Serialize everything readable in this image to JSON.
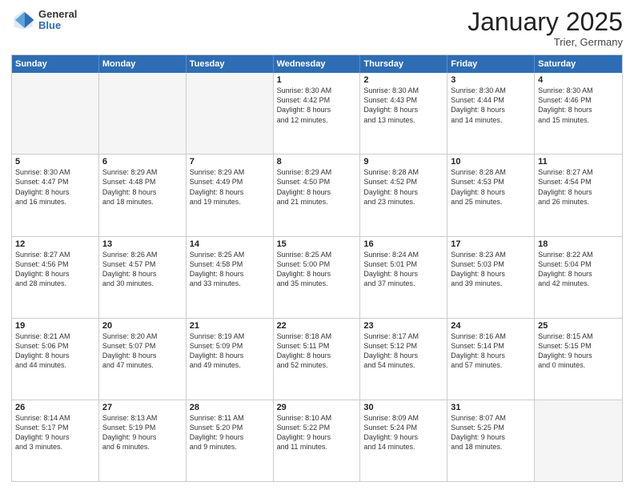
{
  "logo": {
    "general": "General",
    "blue": "Blue"
  },
  "title": "January 2025",
  "location": "Trier, Germany",
  "header_days": [
    "Sunday",
    "Monday",
    "Tuesday",
    "Wednesday",
    "Thursday",
    "Friday",
    "Saturday"
  ],
  "weeks": [
    [
      {
        "day": "",
        "info": ""
      },
      {
        "day": "",
        "info": ""
      },
      {
        "day": "",
        "info": ""
      },
      {
        "day": "1",
        "info": "Sunrise: 8:30 AM\nSunset: 4:42 PM\nDaylight: 8 hours\nand 12 minutes."
      },
      {
        "day": "2",
        "info": "Sunrise: 8:30 AM\nSunset: 4:43 PM\nDaylight: 8 hours\nand 13 minutes."
      },
      {
        "day": "3",
        "info": "Sunrise: 8:30 AM\nSunset: 4:44 PM\nDaylight: 8 hours\nand 14 minutes."
      },
      {
        "day": "4",
        "info": "Sunrise: 8:30 AM\nSunset: 4:46 PM\nDaylight: 8 hours\nand 15 minutes."
      }
    ],
    [
      {
        "day": "5",
        "info": "Sunrise: 8:30 AM\nSunset: 4:47 PM\nDaylight: 8 hours\nand 16 minutes."
      },
      {
        "day": "6",
        "info": "Sunrise: 8:29 AM\nSunset: 4:48 PM\nDaylight: 8 hours\nand 18 minutes."
      },
      {
        "day": "7",
        "info": "Sunrise: 8:29 AM\nSunset: 4:49 PM\nDaylight: 8 hours\nand 19 minutes."
      },
      {
        "day": "8",
        "info": "Sunrise: 8:29 AM\nSunset: 4:50 PM\nDaylight: 8 hours\nand 21 minutes."
      },
      {
        "day": "9",
        "info": "Sunrise: 8:28 AM\nSunset: 4:52 PM\nDaylight: 8 hours\nand 23 minutes."
      },
      {
        "day": "10",
        "info": "Sunrise: 8:28 AM\nSunset: 4:53 PM\nDaylight: 8 hours\nand 25 minutes."
      },
      {
        "day": "11",
        "info": "Sunrise: 8:27 AM\nSunset: 4:54 PM\nDaylight: 8 hours\nand 26 minutes."
      }
    ],
    [
      {
        "day": "12",
        "info": "Sunrise: 8:27 AM\nSunset: 4:56 PM\nDaylight: 8 hours\nand 28 minutes."
      },
      {
        "day": "13",
        "info": "Sunrise: 8:26 AM\nSunset: 4:57 PM\nDaylight: 8 hours\nand 30 minutes."
      },
      {
        "day": "14",
        "info": "Sunrise: 8:25 AM\nSunset: 4:58 PM\nDaylight: 8 hours\nand 33 minutes."
      },
      {
        "day": "15",
        "info": "Sunrise: 8:25 AM\nSunset: 5:00 PM\nDaylight: 8 hours\nand 35 minutes."
      },
      {
        "day": "16",
        "info": "Sunrise: 8:24 AM\nSunset: 5:01 PM\nDaylight: 8 hours\nand 37 minutes."
      },
      {
        "day": "17",
        "info": "Sunrise: 8:23 AM\nSunset: 5:03 PM\nDaylight: 8 hours\nand 39 minutes."
      },
      {
        "day": "18",
        "info": "Sunrise: 8:22 AM\nSunset: 5:04 PM\nDaylight: 8 hours\nand 42 minutes."
      }
    ],
    [
      {
        "day": "19",
        "info": "Sunrise: 8:21 AM\nSunset: 5:06 PM\nDaylight: 8 hours\nand 44 minutes."
      },
      {
        "day": "20",
        "info": "Sunrise: 8:20 AM\nSunset: 5:07 PM\nDaylight: 8 hours\nand 47 minutes."
      },
      {
        "day": "21",
        "info": "Sunrise: 8:19 AM\nSunset: 5:09 PM\nDaylight: 8 hours\nand 49 minutes."
      },
      {
        "day": "22",
        "info": "Sunrise: 8:18 AM\nSunset: 5:11 PM\nDaylight: 8 hours\nand 52 minutes."
      },
      {
        "day": "23",
        "info": "Sunrise: 8:17 AM\nSunset: 5:12 PM\nDaylight: 8 hours\nand 54 minutes."
      },
      {
        "day": "24",
        "info": "Sunrise: 8:16 AM\nSunset: 5:14 PM\nDaylight: 8 hours\nand 57 minutes."
      },
      {
        "day": "25",
        "info": "Sunrise: 8:15 AM\nSunset: 5:15 PM\nDaylight: 9 hours\nand 0 minutes."
      }
    ],
    [
      {
        "day": "26",
        "info": "Sunrise: 8:14 AM\nSunset: 5:17 PM\nDaylight: 9 hours\nand 3 minutes."
      },
      {
        "day": "27",
        "info": "Sunrise: 8:13 AM\nSunset: 5:19 PM\nDaylight: 9 hours\nand 6 minutes."
      },
      {
        "day": "28",
        "info": "Sunrise: 8:11 AM\nSunset: 5:20 PM\nDaylight: 9 hours\nand 9 minutes."
      },
      {
        "day": "29",
        "info": "Sunrise: 8:10 AM\nSunset: 5:22 PM\nDaylight: 9 hours\nand 11 minutes."
      },
      {
        "day": "30",
        "info": "Sunrise: 8:09 AM\nSunset: 5:24 PM\nDaylight: 9 hours\nand 14 minutes."
      },
      {
        "day": "31",
        "info": "Sunrise: 8:07 AM\nSunset: 5:25 PM\nDaylight: 9 hours\nand 18 minutes."
      },
      {
        "day": "",
        "info": ""
      }
    ]
  ]
}
